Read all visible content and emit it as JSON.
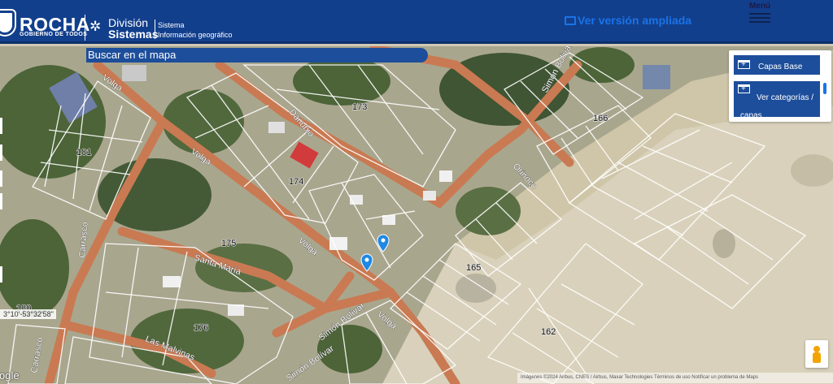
{
  "header": {
    "brand": "ROCHA",
    "brand_sub": "GOBIERNO DE TODOS",
    "division_line1": "División",
    "division_line2": "Sistemas",
    "system_line1": "Sistema",
    "system_line2": "Información geográfico",
    "ampliada": "Ver versión ampliada",
    "menu": "Menú"
  },
  "search": {
    "label": "Buscar en el mapa"
  },
  "panel": {
    "capas_base": "Capas Base",
    "ver_categorias": "Ver categorías / capas"
  },
  "map": {
    "coordinates": "3°10'-53°32'58\"",
    "google": "ogle",
    "attribution": "Imágenes ©2024 Airbus, CNES / Airbus, Maxar Technologies  Términos de uso  Notificar un problema de Maps",
    "street_labels": [
      "Volga",
      "Danubio",
      "Volga",
      "Santa María",
      "Carrasco",
      "Las Malvinas",
      "Simón Bolívar",
      "Volga",
      "Orinoco",
      "Simon Bolivar",
      "Volga",
      "Simón Bolívar",
      "Carrasco"
    ],
    "block_labels": [
      "173",
      "166",
      "181",
      "174",
      "175",
      "165",
      "176",
      "162",
      "180"
    ],
    "colors": {
      "header": "#123f8c",
      "accent": "#1a73e8",
      "road": "#c97a52",
      "sand": "#d8d0ba",
      "vegetation": "#4c6438",
      "marker": "#1e88e5"
    }
  }
}
